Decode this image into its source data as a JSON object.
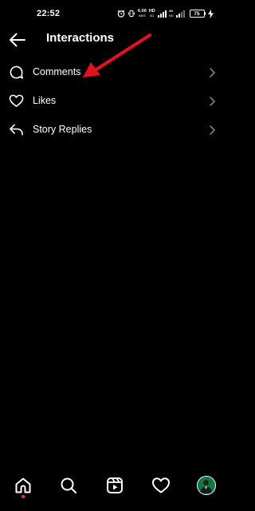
{
  "status_bar": {
    "time": "22:52",
    "net_speed_value": "6.00",
    "net_speed_unit": "KB/S",
    "network_type_top": "HD",
    "network_type_bottom": "4G",
    "battery_level": "75"
  },
  "header": {
    "title": "Interactions"
  },
  "list": {
    "items": [
      {
        "label": "Comments",
        "icon": "comment-icon"
      },
      {
        "label": "Likes",
        "icon": "heart-icon"
      },
      {
        "label": "Story Replies",
        "icon": "reply-icon"
      }
    ]
  },
  "bottom_nav": {
    "items": [
      "home-icon",
      "search-icon",
      "reels-icon",
      "heart-icon",
      "profile-avatar"
    ],
    "active": "home-icon",
    "accent_color": "#ff3040"
  },
  "colors": {
    "background": "#000000",
    "text": "#ffffff",
    "chevron": "#8e8e8e",
    "annotation_arrow": "#e8101a"
  }
}
